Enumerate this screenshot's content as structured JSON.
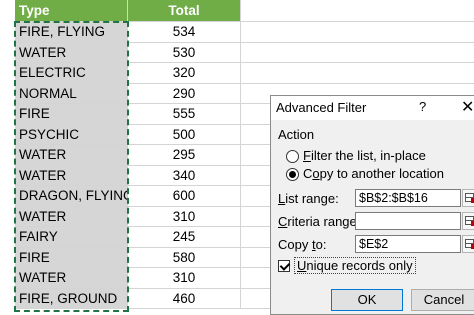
{
  "table": {
    "header": {
      "type": "Type",
      "total": "Total"
    },
    "rows": [
      {
        "type": "FIRE, FLYING",
        "total": "534"
      },
      {
        "type": "WATER",
        "total": "530"
      },
      {
        "type": "ELECTRIC",
        "total": "320"
      },
      {
        "type": "NORMAL",
        "total": "290"
      },
      {
        "type": "FIRE",
        "total": "555"
      },
      {
        "type": "PSYCHIC",
        "total": "500"
      },
      {
        "type": "WATER",
        "total": "295"
      },
      {
        "type": "WATER",
        "total": "340"
      },
      {
        "type": "DRAGON, FLYING",
        "total": "600"
      },
      {
        "type": "WATER",
        "total": "310"
      },
      {
        "type": "FAIRY",
        "total": "245"
      },
      {
        "type": "FIRE",
        "total": "580"
      },
      {
        "type": "WATER",
        "total": "310"
      },
      {
        "type": "FIRE, GROUND",
        "total": "460"
      }
    ]
  },
  "dialog": {
    "title": "Advanced Filter",
    "help": "?",
    "close": "✕",
    "action_label": "Action",
    "radio_filter": {
      "prefix": "",
      "accel": "F",
      "rest": "ilter the list, in-place"
    },
    "radio_copy": {
      "prefix": "C",
      "accel": "o",
      "rest": "py to another location"
    },
    "list_range": {
      "accel": "L",
      "rest": "ist range:",
      "value": "$B$2:$B$16"
    },
    "criteria_range": {
      "accel": "C",
      "rest": "riteria range:",
      "value": ""
    },
    "copy_to": {
      "prefix": "Copy ",
      "accel": "t",
      "rest": "o:",
      "value": "$E$2"
    },
    "unique": {
      "prefix": "",
      "accel": "U",
      "rest": "nique records only"
    },
    "ok": "OK",
    "cancel": "Cancel"
  },
  "colors": {
    "header_green": "#70ad47",
    "selection_gray": "#d6d6d6",
    "marquee": "#217346"
  }
}
